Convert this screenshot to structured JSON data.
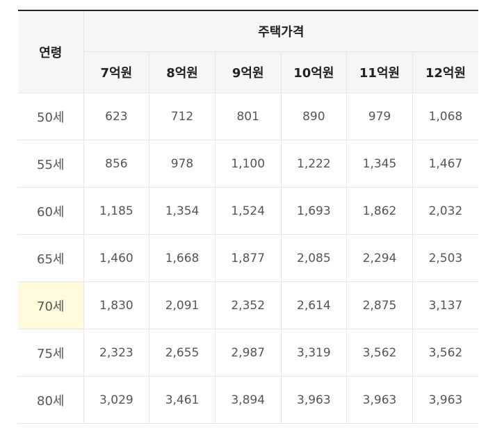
{
  "header": {
    "age_label": "연령",
    "price_label": "주택가격",
    "price_columns": [
      "7억원",
      "8억원",
      "9억원",
      "10억원",
      "11억원",
      "12억원"
    ]
  },
  "rows": [
    {
      "age": "50세",
      "values": [
        "623",
        "712",
        "801",
        "890",
        "979",
        "1,068"
      ],
      "highlight": false
    },
    {
      "age": "55세",
      "values": [
        "856",
        "978",
        "1,100",
        "1,222",
        "1,345",
        "1,467"
      ],
      "highlight": false
    },
    {
      "age": "60세",
      "values": [
        "1,185",
        "1,354",
        "1,524",
        "1,693",
        "1,862",
        "2,032"
      ],
      "highlight": false
    },
    {
      "age": "65세",
      "values": [
        "1,460",
        "1,668",
        "1,877",
        "2,085",
        "2,294",
        "2,503"
      ],
      "highlight": false
    },
    {
      "age": "70세",
      "values": [
        "1,830",
        "2,091",
        "2,352",
        "2,614",
        "2,875",
        "3,137"
      ],
      "highlight": true
    },
    {
      "age": "75세",
      "values": [
        "2,323",
        "2,655",
        "2,987",
        "3,319",
        "3,562",
        "3,562"
      ],
      "highlight": false
    },
    {
      "age": "80세",
      "values": [
        "3,029",
        "3,461",
        "3,894",
        "3,963",
        "3,963",
        "3,963"
      ],
      "highlight": false
    }
  ],
  "colors": {
    "header_bg": "#f6f6f6",
    "highlight_bg": "#fffbdc",
    "top_border": "#222222",
    "grid": "#e5e5e5"
  }
}
